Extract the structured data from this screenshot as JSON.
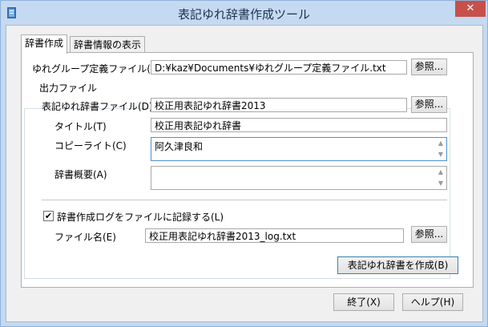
{
  "window": {
    "title": "表記ゆれ辞書作成ツール",
    "close_glyph": "✕"
  },
  "tabs": [
    {
      "label": "辞書作成"
    },
    {
      "label": "辞書情報の表示"
    }
  ],
  "form": {
    "group_def_label": "ゆれグループ定義ファイル(G)",
    "group_def_value": "D:¥kaz¥Documents¥ゆれグループ定義ファイル.txt",
    "browse_label": "参照...",
    "output_group_title": "出力ファイル",
    "dict_file_label": "表記ゆれ辞書ファイル(D)",
    "dict_file_value": "校正用表記ゆれ辞書2013",
    "title_label": "タイトル(T)",
    "title_value": "校正用表記ゆれ辞書",
    "copyright_label": "コピーライト(C)",
    "copyright_value": "阿久津良和",
    "summary_label": "辞書概要(A)",
    "summary_value": "",
    "log_checkbox_label": "辞書作成ログをファイルに記録する(L)",
    "log_checked_glyph": "✔",
    "filename_label": "ファイル名(E)",
    "filename_value": "校正用表記ゆれ辞書2013_log.txt",
    "create_button": "表記ゆれ辞書を作成(B)"
  },
  "footer": {
    "exit_button": "終了(X)",
    "help_button": "ヘルプ(H)"
  }
}
